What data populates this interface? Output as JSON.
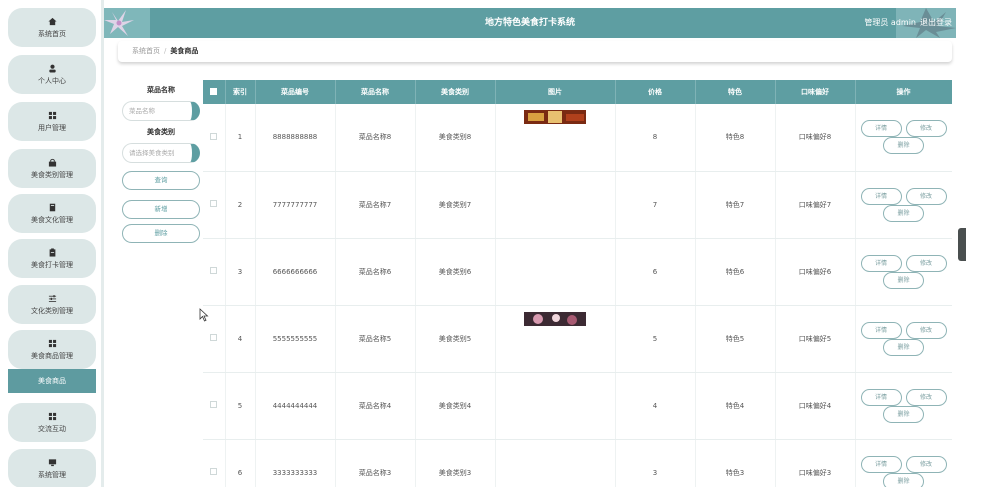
{
  "header": {
    "title": "地方特色美食打卡系统",
    "user_label": "管理员 admin",
    "logout_label": "退出登录"
  },
  "sidebar": {
    "items": [
      {
        "label": "系统首页",
        "icon": "home-icon"
      },
      {
        "label": "个人中心",
        "icon": "user-icon"
      },
      {
        "label": "用户管理",
        "icon": "grid-icon"
      },
      {
        "label": "美食类别管理",
        "icon": "bag-icon"
      },
      {
        "label": "美食文化管理",
        "icon": "book-icon"
      },
      {
        "label": "美食打卡管理",
        "icon": "clipboard-icon"
      },
      {
        "label": "文化类别管理",
        "icon": "sliders-icon"
      },
      {
        "label": "美食商品管理",
        "icon": "grid-icon"
      },
      {
        "label": "交流互动",
        "icon": "grid-icon"
      },
      {
        "label": "系统管理",
        "icon": "monitor-icon"
      }
    ],
    "active_sub": "美食商品"
  },
  "breadcrumb": {
    "home": "系统首页",
    "separator": "/",
    "current": "美食商品"
  },
  "search": {
    "name_label": "菜品名称",
    "name_placeholder": "菜品名称",
    "category_label": "美食类别",
    "category_placeholder": "请选择美食类别",
    "query_button": "查询",
    "add_button": "新增",
    "delete_button": "删除"
  },
  "table": {
    "headers": [
      "索引",
      "菜品编号",
      "菜品名称",
      "美食类别",
      "图片",
      "价格",
      "特色",
      "口味偏好",
      "操作"
    ],
    "actions": {
      "detail": "详情",
      "edit": "修改",
      "delete": "删除"
    },
    "rows": [
      {
        "index": "1",
        "code": "8888888888",
        "name": "菜品名称8",
        "category": "美食类别8",
        "has_image": true,
        "price": "8",
        "feature": "特色8",
        "taste": "口味偏好8"
      },
      {
        "index": "2",
        "code": "7777777777",
        "name": "菜品名称7",
        "category": "美食类别7",
        "has_image": false,
        "price": "7",
        "feature": "特色7",
        "taste": "口味偏好7"
      },
      {
        "index": "3",
        "code": "6666666666",
        "name": "菜品名称6",
        "category": "美食类别6",
        "has_image": false,
        "price": "6",
        "feature": "特色6",
        "taste": "口味偏好6"
      },
      {
        "index": "4",
        "code": "5555555555",
        "name": "菜品名称5",
        "category": "美食类别5",
        "has_image": true,
        "price": "5",
        "feature": "特色5",
        "taste": "口味偏好5"
      },
      {
        "index": "5",
        "code": "4444444444",
        "name": "菜品名称4",
        "category": "美食类别4",
        "has_image": false,
        "price": "4",
        "feature": "特色4",
        "taste": "口味偏好4"
      },
      {
        "index": "6",
        "code": "3333333333",
        "name": "菜品名称3",
        "category": "美食类别3",
        "has_image": false,
        "price": "3",
        "feature": "特色3",
        "taste": "口味偏好3"
      }
    ]
  },
  "colors": {
    "primary": "#5e9ea2",
    "nav_bg": "#dce7e7",
    "nav_active": "#5e9ba0"
  }
}
